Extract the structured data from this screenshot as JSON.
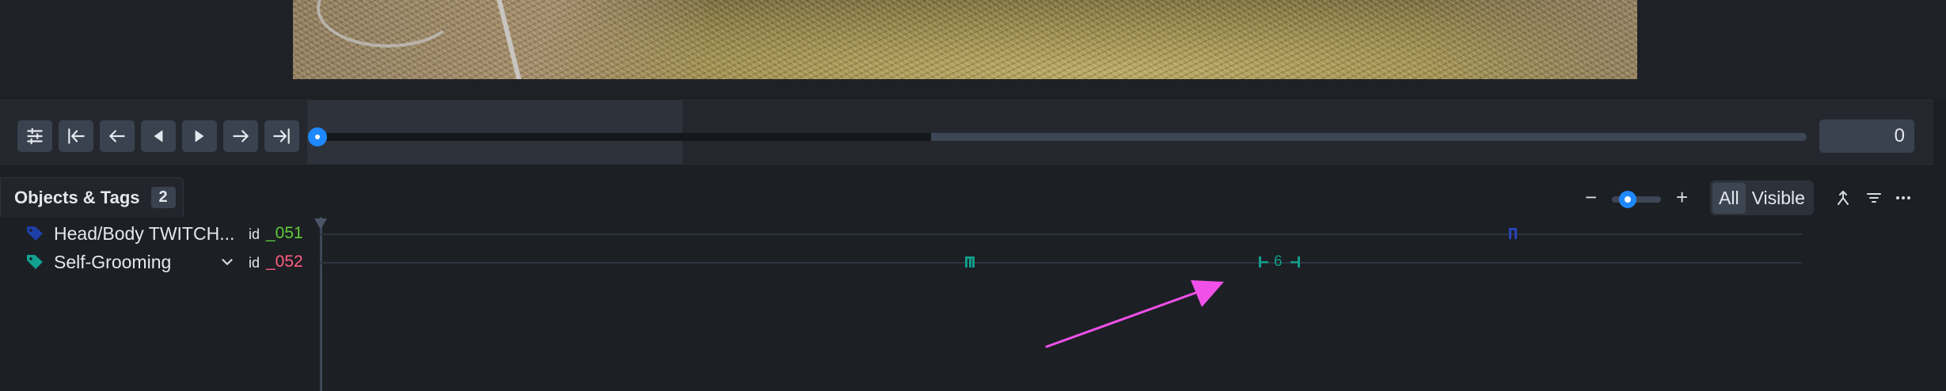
{
  "controls": {
    "frame_value": "0",
    "buttons": [
      {
        "name": "settings-button",
        "icon": "sliders-icon"
      },
      {
        "name": "first-frame-button",
        "icon": "skip-to-start-icon"
      },
      {
        "name": "step-back-button",
        "icon": "arrow-left-icon"
      },
      {
        "name": "play-reverse-button",
        "icon": "play-left-icon"
      },
      {
        "name": "play-button",
        "icon": "play-right-icon"
      },
      {
        "name": "step-forward-button",
        "icon": "arrow-right-icon"
      },
      {
        "name": "last-frame-button",
        "icon": "skip-to-end-icon"
      }
    ],
    "colors": {
      "accent": "#1e88ff"
    }
  },
  "panel": {
    "tab_label": "Objects & Tags",
    "tab_count": "2",
    "zoom_minus": "−",
    "zoom_plus": "+",
    "filter_all": "All",
    "filter_visible": "Visible"
  },
  "rows": [
    {
      "name": "Head/Body TWITCH...",
      "id_label": "id",
      "id_value": "_051",
      "tag_color": "#1f3fa8",
      "id_color": "#5ecb3a"
    },
    {
      "name": "Self-Grooming",
      "id_label": "id",
      "id_value": "_052",
      "tag_color": "#12a091",
      "id_color": "#ff5f7e"
    }
  ],
  "marks": {
    "segment_count": "6",
    "colors": {
      "row1": "#2845b8",
      "row2": "#129c8a",
      "annotation_arrow": "#f050e8"
    }
  }
}
